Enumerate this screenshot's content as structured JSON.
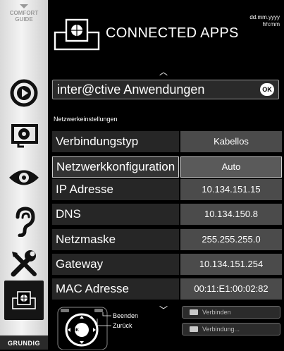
{
  "sidebar": {
    "comfort_line1": "COMFORT",
    "comfort_line2": "GUIDE",
    "brand": "GRUNDIG",
    "items": [
      {
        "icon": "play-circle-icon"
      },
      {
        "icon": "settings-screen-icon"
      },
      {
        "icon": "eye-icon"
      },
      {
        "icon": "ear-icon"
      },
      {
        "icon": "tools-icon"
      },
      {
        "icon": "connected-apps-icon",
        "active": true
      }
    ]
  },
  "header": {
    "title": "CONNECTED APPS",
    "date": "dd.mm.yyyy",
    "time": "hh:mm"
  },
  "interactive": {
    "label": "inter@ctive Anwendungen",
    "ok": "OK"
  },
  "section_label": "Netzwerkeinstellungen",
  "rows": [
    {
      "key": "Verbindungstyp",
      "value": "Kabellos",
      "selected": false
    },
    {
      "key": "Netzwerkkonfiguration",
      "value": "Auto",
      "selected": true
    },
    {
      "key": "IP Adresse",
      "value": "10.134.151.15",
      "selected": false
    },
    {
      "key": "DNS",
      "value": "10.134.150.8",
      "selected": false
    },
    {
      "key": "Netzmaske",
      "value": "255.255.255.0",
      "selected": false
    },
    {
      "key": "Gateway",
      "value": "10.134.151.254",
      "selected": false
    },
    {
      "key": "MAC Adresse",
      "value": "00:11:E1:00:02:82",
      "selected": false
    }
  ],
  "legend": {
    "beenden": "Beenden",
    "zurueck": "Zurück",
    "ok": "OK"
  },
  "actions": {
    "connect": "Verbinden",
    "connection": "Verbindung..."
  }
}
